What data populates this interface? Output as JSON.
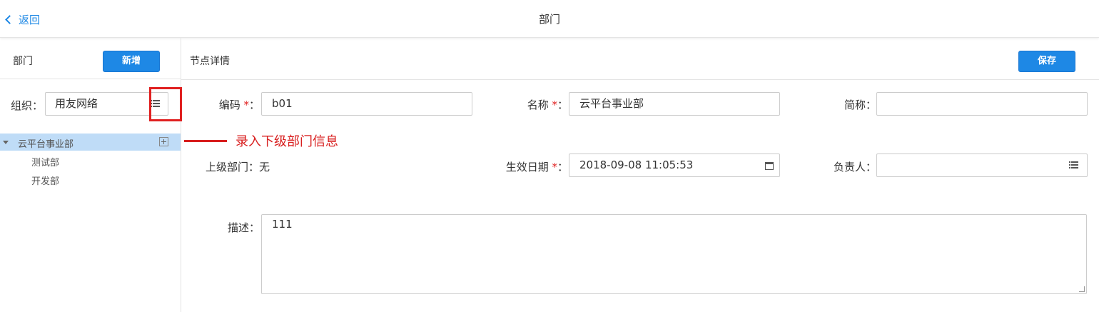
{
  "header": {
    "back_label": "返回",
    "title": "部门"
  },
  "sidebar": {
    "title": "部门",
    "new_button": "新增",
    "org_label": "组织：",
    "org_value": "用友网络",
    "tree": {
      "root": "云平台事业部",
      "children": [
        "测试部",
        "开发部"
      ]
    }
  },
  "annotation": {
    "text": "录入下级部门信息"
  },
  "main": {
    "title": "节点详情",
    "save_button": "保存",
    "fields": {
      "code": {
        "label": "编码",
        "value": "b01"
      },
      "name": {
        "label": "名称",
        "value": "云平台事业部"
      },
      "short_name": {
        "label": "简称：",
        "value": ""
      },
      "parent": {
        "label": "上级部门：",
        "value": "无"
      },
      "effective_date": {
        "label": "生效日期",
        "value": "2018-09-08 11:05:53"
      },
      "owner": {
        "label": "负责人：",
        "value": ""
      },
      "description": {
        "label": "描述：",
        "value": "111"
      }
    },
    "required_mark": "*",
    "colon": "："
  },
  "colors": {
    "accent": "#1e88e5",
    "selection": "#bfdcf7",
    "annotation": "#d81e1e"
  }
}
